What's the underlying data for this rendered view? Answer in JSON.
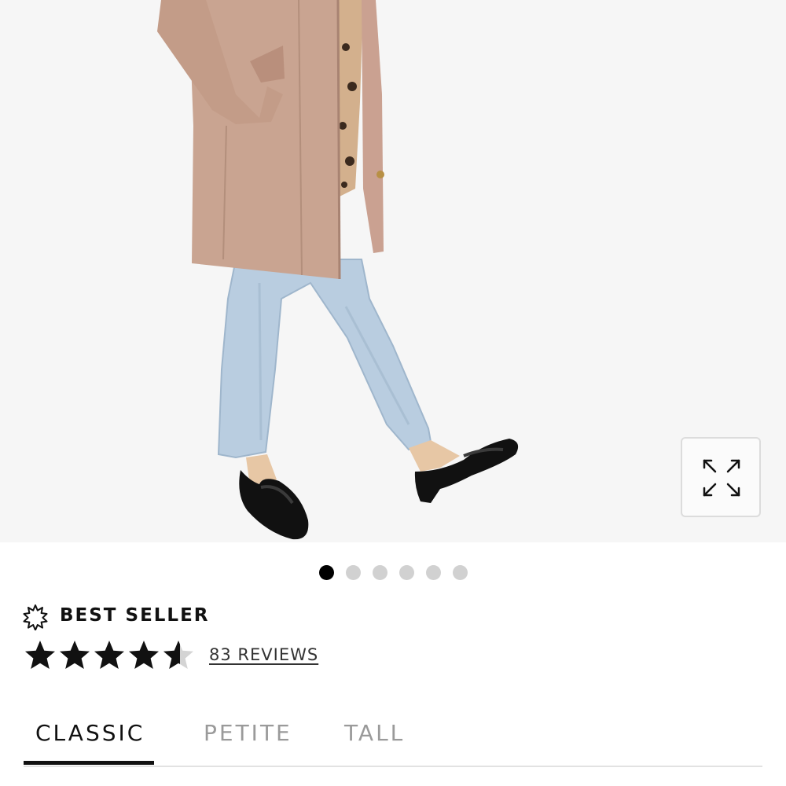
{
  "product": {
    "badge_icon": "starburst-badge-icon",
    "badge_label": "BEST SELLER",
    "rating": 4.5,
    "rating_max": 5,
    "reviews_label": "83 REVIEWS"
  },
  "gallery": {
    "image_count": 6,
    "active_index": 0,
    "expand_icon": "expand-arrows-icon"
  },
  "size_tabs": [
    {
      "label": "CLASSIC",
      "active": true
    },
    {
      "label": "PETITE",
      "active": false
    },
    {
      "label": "TALL",
      "active": false
    }
  ],
  "colors": {
    "accent": "#000000",
    "inactive_dot": "#d1d1d1",
    "inactive_tab": "#9a9a9a",
    "image_background": "#f6f6f6"
  }
}
